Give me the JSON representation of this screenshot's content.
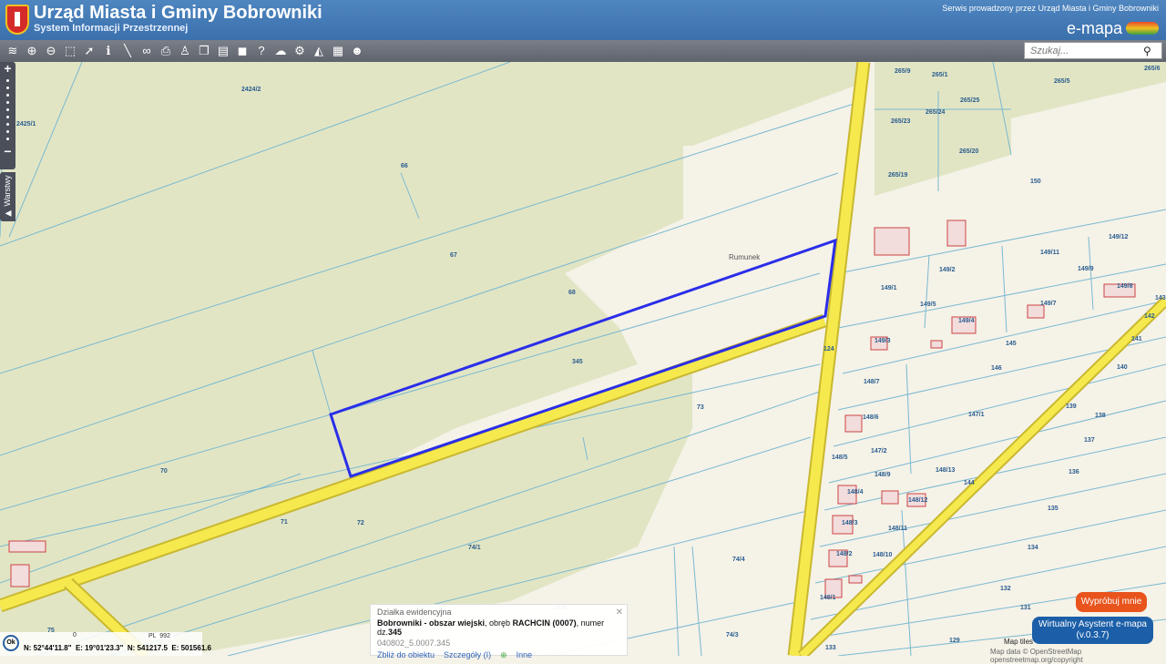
{
  "header": {
    "title": "Urząd Miasta i Gminy Bobrowniki",
    "subtitle": "System Informacji Przestrzennej",
    "service": "Serwis prowadzony przez Urząd Miasta i Gminy Bobrowniki",
    "brand": "e-mapa"
  },
  "toolbar": [
    "layers-icon",
    "zoom-in-icon",
    "zoom-out-icon",
    "full-extent-icon",
    "pointer-icon",
    "info-icon",
    "measure-icon",
    "link-icon",
    "print-icon",
    "street-view-icon",
    "copy-icon",
    "panels-icon",
    "comment-icon",
    "help-icon",
    "cloud-icon",
    "settings-icon",
    "sail-icon",
    "palette-icon",
    "assistant-icon"
  ],
  "search": {
    "placeholder": "Szukaj..."
  },
  "zoom": {
    "plus": "+",
    "minus": "−",
    "layers": "▶ Warstwy"
  },
  "map": {
    "place": "Rumunek",
    "labels": [
      "2424/2",
      "2425/1",
      "66",
      "67",
      "68",
      "345",
      "73",
      "70",
      "71",
      "72",
      "74/1",
      "74/4",
      "74/3",
      "124",
      "265/9",
      "265/1",
      "265/6",
      "265/5",
      "265/25",
      "265/24",
      "265/23",
      "265/20",
      "265/19",
      "150",
      "149/12",
      "149/11",
      "149/9",
      "149/2",
      "149/1",
      "149/5",
      "149/7",
      "149/8",
      "149/4",
      "149/3",
      "145",
      "146",
      "148/7",
      "148/6",
      "148/5",
      "147/1",
      "147/2",
      "148/9",
      "148/13",
      "144",
      "148/4",
      "148/12",
      "148/3",
      "148/11",
      "148/2",
      "148/10",
      "148/1",
      "143",
      "142",
      "141",
      "140",
      "139",
      "138",
      "137",
      "136",
      "135",
      "134",
      "133",
      "132",
      "131",
      "129",
      "75",
      "14/5"
    ]
  },
  "popup": {
    "type": "Działka ewidencyjna",
    "place": "Bobrowniki - obszar wiejski",
    "precinct_prefix": ", obręb ",
    "precinct": "RACHCIN (0007)",
    "number_prefix": ", numer dz.",
    "number": "345",
    "id": "040802_5.0007.345",
    "zoom_link": "Zbliż do obiektu",
    "details_link": "Szczegóły (I)",
    "other_link": "Inne"
  },
  "coords": {
    "lat": "N: 52°44'11.8\"",
    "lon": "E: 19°01'23.3\"",
    "n": "N: 541217.5",
    "e": "E: 501561.6",
    "ok": "Ok",
    "scale": "0",
    "crs": "PL  992"
  },
  "assistant": {
    "try": "Wypróbuj mnie",
    "name": "Wirtualny Asystent e-mapa",
    "version": "(v.0.3.7)"
  },
  "attribution": {
    "tiles": "Map tiles",
    "data": "Map data © OpenStreetMap openstreetmap.org/copyright"
  },
  "colors": {
    "parcel": "#2a2ee8",
    "road": "#f5e94e",
    "green": "#e2e5c4",
    "line": "#7ab9d0"
  }
}
